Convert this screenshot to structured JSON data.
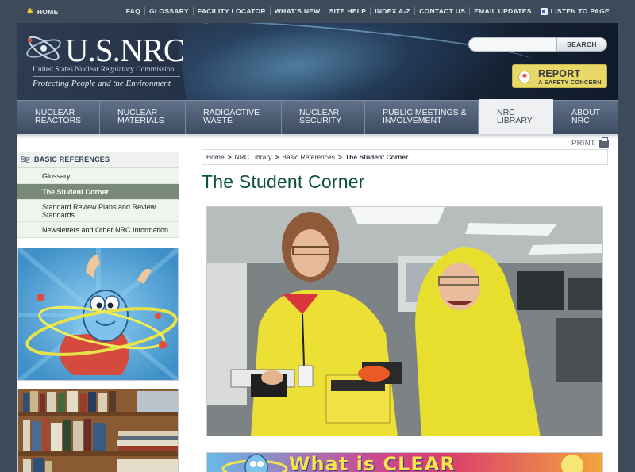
{
  "topbar": {
    "home": "HOME",
    "links": [
      "FAQ",
      "GLOSSARY",
      "FACILITY LOCATOR",
      "WHAT'S NEW",
      "SITE HELP",
      "INDEX A-Z",
      "CONTACT US",
      "EMAIL UPDATES"
    ],
    "listen": "LISTEN TO PAGE"
  },
  "header": {
    "logo": "U.S.NRC",
    "subtitle": "United States Nuclear Regulatory Commission",
    "tagline": "Protecting People and the Environment",
    "search_button": "SEARCH",
    "report_line1": "REPORT",
    "report_line2": "A SAFETY CONCERN"
  },
  "nav": {
    "tabs": [
      {
        "line1": "NUCLEAR",
        "line2": "REACTORS"
      },
      {
        "line1": "NUCLEAR",
        "line2": "MATERIALS"
      },
      {
        "line1": "RADIOACTIVE",
        "line2": "WASTE"
      },
      {
        "line1": "NUCLEAR",
        "line2": "SECURITY"
      },
      {
        "line1": "PUBLIC MEETINGS &",
        "line2": "INVOLVEMENT"
      },
      {
        "line1": "NRC",
        "line2": "LIBRARY"
      },
      {
        "line1": "ABOUT",
        "line2": "NRC"
      }
    ]
  },
  "print_label": "PRINT",
  "sidebar": {
    "heading": "BASIC REFERENCES",
    "items": [
      "Glossary",
      "The Student Corner",
      "Standard Review Plans and Review Standards",
      "Newsletters and Other NRC Information"
    ]
  },
  "breadcrumb": {
    "items": [
      "Home",
      "NRC Library",
      "Basic References"
    ],
    "current": "The Student Corner"
  },
  "page_title": "The Student Corner",
  "banner_text": "What is CLEAR"
}
